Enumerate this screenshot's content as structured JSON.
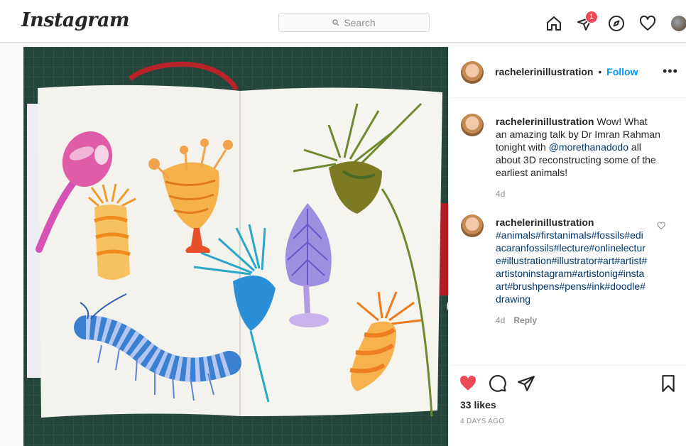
{
  "header": {
    "logo": "Instagram",
    "search_placeholder": "Search",
    "notification_count": "1",
    "icons": [
      "home-icon",
      "direct-message-icon",
      "explore-compass-icon",
      "activity-heart-icon",
      "profile-avatar"
    ]
  },
  "post": {
    "author": "rachelerinillustration",
    "separator": "•",
    "follow_label": "Follow",
    "more_label": "•••",
    "caption": {
      "username": "rachelerinillustration",
      "text_before": "Wow! What an amazing talk by Dr Imran Rahman tonight with ",
      "mention": "@morethanadodo",
      "text_after": " all about 3D reconstructing some of the earliest animals!",
      "time": "4d"
    },
    "comment": {
      "username": "rachelerinillustration",
      "hashtags": "#animals#firstanimals#fossils#ediacaranfossils#lecture#onlinelecture#illustration#illustrator#art#artist#artistoninstagram#artistonig#instaart#brushpens#pens#ink#doodle#drawing",
      "time": "4d",
      "reply_label": "Reply"
    },
    "likes": "33 likes",
    "date": "4 DAYS AGO"
  },
  "colors": {
    "like_red": "#ed4956",
    "link_blue": "#0095f6",
    "hashtag_blue": "#00376b",
    "mat_green": "#23453a"
  }
}
